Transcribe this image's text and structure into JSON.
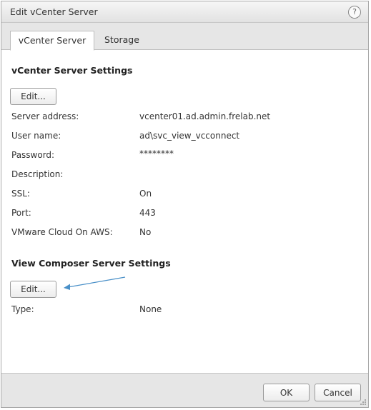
{
  "dialog": {
    "title": "Edit vCenter Server",
    "help_symbol": "?"
  },
  "tabs": [
    {
      "label": "vCenter Server",
      "active": true
    },
    {
      "label": "Storage",
      "active": false
    }
  ],
  "vcenter_settings": {
    "heading": "vCenter Server Settings",
    "edit_label": "Edit...",
    "rows": [
      {
        "label": "Server address:",
        "value": "vcenter01.ad.admin.frelab.net"
      },
      {
        "label": "User name:",
        "value": "ad\\svc_view_vcconnect"
      },
      {
        "label": "Password:",
        "value": "********"
      },
      {
        "label": "Description:",
        "value": ""
      },
      {
        "label": "SSL:",
        "value": "On"
      },
      {
        "label": "Port:",
        "value": "443"
      },
      {
        "label": "VMware Cloud On AWS:",
        "value": "No"
      }
    ]
  },
  "composer_settings": {
    "heading": "View Composer Server Settings",
    "edit_label": "Edit...",
    "rows": [
      {
        "label": "Type:",
        "value": "None"
      }
    ]
  },
  "footer": {
    "ok_label": "OK",
    "cancel_label": "Cancel"
  },
  "colors": {
    "annotation_arrow": "#4a90c8"
  }
}
